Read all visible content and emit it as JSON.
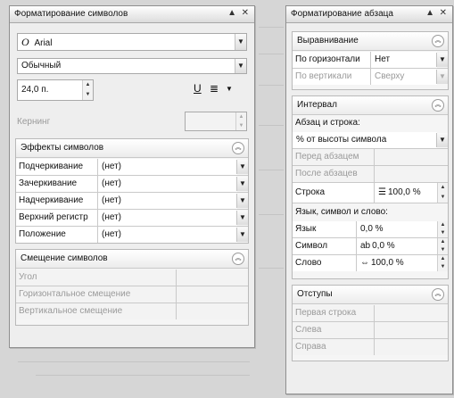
{
  "char_panel": {
    "title": "Форматирование символов",
    "font_prefix": "O",
    "font_name": "Arial",
    "style": "Обычный",
    "size": "24,0 п.",
    "kerning_label": "Кернинг",
    "effects": {
      "title": "Эффекты символов",
      "rows": [
        {
          "label": "Подчеркивание",
          "value": "(нет)"
        },
        {
          "label": "Зачеркивание",
          "value": "(нет)"
        },
        {
          "label": "Надчеркивание",
          "value": "(нет)"
        },
        {
          "label": "Верхний регистр",
          "value": "(нет)"
        },
        {
          "label": "Положение",
          "value": "(нет)"
        }
      ]
    },
    "offset": {
      "title": "Смещение символов",
      "rows": [
        {
          "label": "Угол"
        },
        {
          "label": "Горизонтальное смещение"
        },
        {
          "label": "Вертикальное смещение"
        }
      ]
    }
  },
  "para_panel": {
    "title": "Форматирование абзаца",
    "alignment": {
      "title": "Выравнивание",
      "horizontal_label": "По горизонтали",
      "horizontal_value": "Нет",
      "vertical_label": "По вертикали",
      "vertical_value": "Сверху"
    },
    "interval": {
      "title": "Интервал",
      "para_line_label": "Абзац и строка:",
      "spacing_mode": "% от высоты символа",
      "before_label": "Перед абзацем",
      "after_label": "После абзацев",
      "line_label": "Строка",
      "line_value": "100,0 %",
      "lang_label": "Язык, символ и слово:",
      "rows": [
        {
          "label": "Язык",
          "value": "0,0 %"
        },
        {
          "label": "Символ",
          "value": "0,0 %"
        },
        {
          "label": "Слово",
          "value": "100,0 %"
        }
      ]
    },
    "indents": {
      "title": "Отступы",
      "rows": [
        {
          "label": "Первая строка"
        },
        {
          "label": "Слева"
        },
        {
          "label": "Справа"
        }
      ]
    }
  }
}
